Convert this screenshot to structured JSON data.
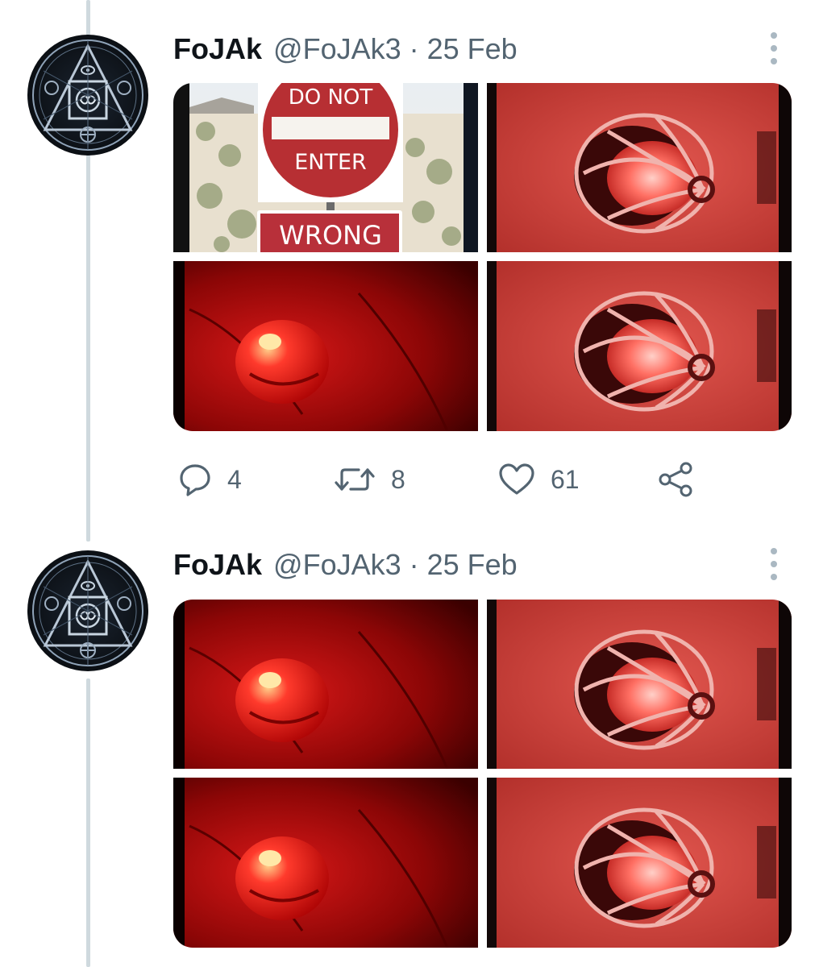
{
  "tweets": [
    {
      "display_name": "FoJAk",
      "handle": "@FoJAk3",
      "separator": "·",
      "date": "25 Feb",
      "media": [
        {
          "type": "no-entry-sign",
          "sign_text_top": "DO NOT",
          "sign_text_bottom": "ENTER",
          "sign_text_lower": "WRONG"
        },
        {
          "type": "caged-red-lamp"
        },
        {
          "type": "red-beacon"
        },
        {
          "type": "caged-red-lamp"
        }
      ],
      "actions": {
        "reply_count": "4",
        "retweet_count": "8",
        "like_count": "61"
      }
    },
    {
      "display_name": "FoJAk",
      "handle": "@FoJAk3",
      "separator": "·",
      "date": "25 Feb",
      "media": [
        {
          "type": "red-beacon"
        },
        {
          "type": "caged-red-lamp"
        },
        {
          "type": "red-beacon"
        },
        {
          "type": "caged-red-lamp"
        }
      ]
    }
  ],
  "icons": {
    "reply": "speech-bubble-icon",
    "retweet": "retweet-arrows-icon",
    "like": "heart-icon",
    "share": "share-nodes-icon",
    "more": "vertical-dots-icon"
  },
  "colors": {
    "text_primary": "#0f1419",
    "text_secondary": "#536471",
    "thread_line": "#cfd9de"
  }
}
